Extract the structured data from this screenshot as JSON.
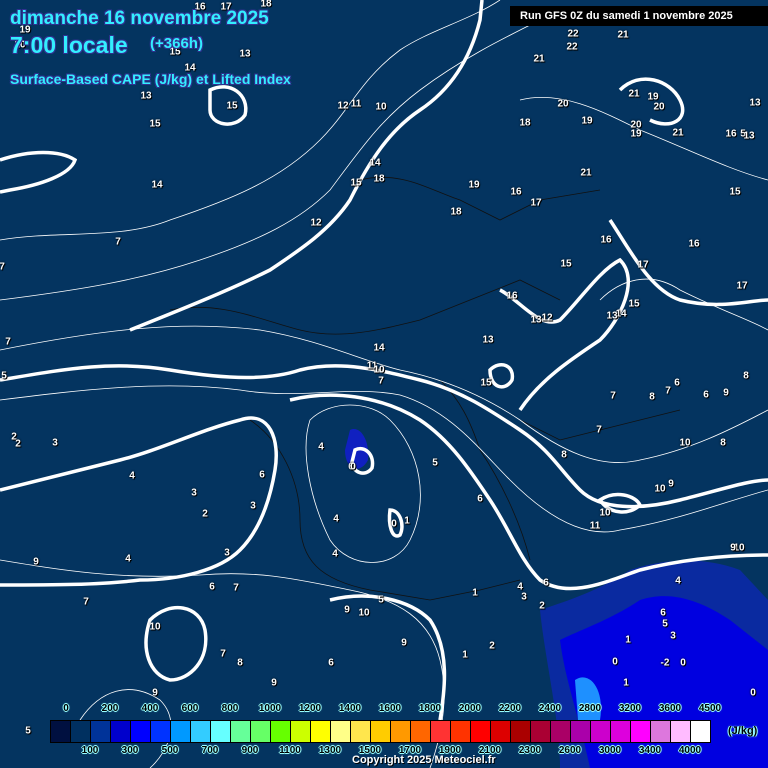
{
  "header": {
    "date": "dimanche 16 novembre 2025",
    "time": "7:00 locale",
    "lead": "(+366h)",
    "product": "Surface-Based CAPE (J/kg) et Lifted Index",
    "run": "Run GFS 0Z du samedi 1 novembre 2025"
  },
  "colors": {
    "background": "#043460",
    "contour": "#ffffff",
    "title": "#33eeff",
    "cape_low": "#0000ff"
  },
  "legend": {
    "unit": "(J/kg)",
    "top_labels": [
      "0",
      "200",
      "400",
      "600",
      "800",
      "1000",
      "1200",
      "1400",
      "1600",
      "1800",
      "2000",
      "2200",
      "2400",
      "2800",
      "3200",
      "3600",
      "4500"
    ],
    "bottom_labels": [
      "100",
      "300",
      "500",
      "700",
      "900",
      "1100",
      "1300",
      "1500",
      "1700",
      "1900",
      "2100",
      "2300",
      "2600",
      "3000",
      "3400",
      "4000"
    ],
    "swatches": [
      "#001040",
      "#003060",
      "#003399",
      "#0000cc",
      "#0000ff",
      "#0033ff",
      "#0099ff",
      "#33ccff",
      "#66ffff",
      "#66ff99",
      "#66ff66",
      "#66ff00",
      "#ccff00",
      "#ffff00",
      "#ffff88",
      "#ffe64d",
      "#ffcc00",
      "#ff9900",
      "#ff6600",
      "#ff3333",
      "#ff3300",
      "#ff0000",
      "#dd0000",
      "#aa0000",
      "#aa0033",
      "#aa0066",
      "#aa00aa",
      "#cc00cc",
      "#dd00dd",
      "#ff00ff",
      "#dd77dd",
      "#ffbbff",
      "#ffffff"
    ]
  },
  "contour_labels": [
    "16",
    "17",
    "18",
    "19",
    "20",
    "13",
    "15",
    "14",
    "13",
    "15",
    "12",
    "11",
    "10",
    "15",
    "14",
    "14",
    "15",
    "18",
    "12",
    "7",
    "7",
    "7",
    "5",
    "22",
    "22",
    "21",
    "21",
    "20",
    "19",
    "21",
    "19",
    "20",
    "20",
    "19",
    "21",
    "18",
    "19",
    "16",
    "17",
    "18",
    "21",
    "13",
    "16",
    "5",
    "13",
    "15",
    "16",
    "16",
    "15",
    "17",
    "17",
    "16",
    "15",
    "14",
    "13",
    "13",
    "12",
    "13",
    "14",
    "11",
    "10",
    "7",
    "15",
    "8",
    "7",
    "8",
    "7",
    "6",
    "6",
    "9",
    "2",
    "2",
    "3",
    "4",
    "6",
    "0",
    "5",
    "4",
    "3",
    "3",
    "2",
    "6",
    "10",
    "8",
    "7",
    "8",
    "6",
    "10",
    "9",
    "10",
    "11",
    "4",
    "0",
    "1",
    "4",
    "3",
    "4",
    "9",
    "10",
    "9",
    "6",
    "7",
    "7",
    "4",
    "3",
    "6",
    "1",
    "2",
    "9",
    "10",
    "5",
    "10",
    "7",
    "8",
    "6",
    "9",
    "1",
    "2",
    "9",
    "9",
    "1",
    "0",
    "-2",
    "0",
    "5",
    "6",
    "3",
    "1",
    "0",
    "4",
    "5"
  ],
  "copyright": "Copyright 2025 Meteociel.fr"
}
